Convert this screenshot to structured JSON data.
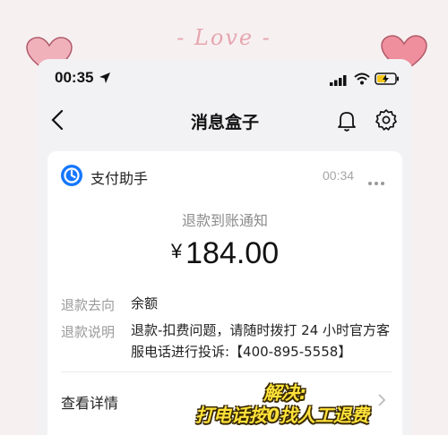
{
  "decor": {
    "love_text": "- Love -"
  },
  "status_bar": {
    "time": "00:35"
  },
  "nav": {
    "title": "消息盒子"
  },
  "message": {
    "app_name": "支付助手",
    "time": "00:34",
    "notice_title": "退款到账通知",
    "currency": "¥",
    "amount": "184.00",
    "fields": [
      {
        "label": "退款去向",
        "value": "余额"
      },
      {
        "label": "退款说明",
        "value": "退款-扣费问题，请随时拨打 24 小时官方客服电话进行投诉:【400-895-5558】"
      }
    ],
    "details_label": "查看详情"
  },
  "overlay": {
    "line1": "解决:",
    "line2": "打电话按0找人工退费"
  },
  "colors": {
    "accent": "#1677ff",
    "overlay_text": "#ffe23a",
    "heart": "#ef9aa6"
  },
  "icons": [
    "location-arrow-icon",
    "signal-icon",
    "wifi-icon",
    "battery-charging-icon",
    "back-icon",
    "bell-icon",
    "gear-icon",
    "alipay-logo-icon",
    "more-icon",
    "chevron-right-icon",
    "heart-icon"
  ]
}
